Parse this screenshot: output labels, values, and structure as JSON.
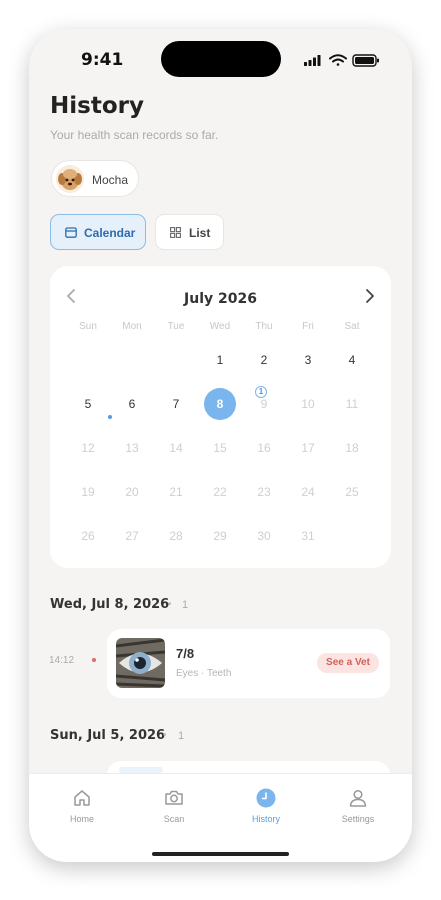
{
  "status": {
    "time": "9:41"
  },
  "header": {
    "title": "History",
    "subtitle": "Your health scan records so far."
  },
  "pet": {
    "name": "Mocha"
  },
  "view_toggle": {
    "calendar_label": "Calendar",
    "list_label": "List",
    "selected": "Calendar"
  },
  "calendar": {
    "month_label": "July 2026",
    "weekdays": [
      "Sun",
      "Mon",
      "Tue",
      "Wed",
      "Thu",
      "Fri",
      "Sat"
    ],
    "selected_day": "8",
    "selected_badge": "1",
    "days": [
      {
        "num": "1",
        "state": "normal"
      },
      {
        "num": "2",
        "state": "normal"
      },
      {
        "num": "3",
        "state": "normal"
      },
      {
        "num": "4",
        "state": "normal"
      },
      {
        "num": "5",
        "state": "normal"
      },
      {
        "num": "6",
        "state": "normal"
      },
      {
        "num": "7",
        "state": "normal"
      },
      {
        "num": "8",
        "state": "selected"
      },
      {
        "num": "9",
        "state": "muted"
      },
      {
        "num": "10",
        "state": "muted"
      },
      {
        "num": "11",
        "state": "muted"
      },
      {
        "num": "12",
        "state": "muted"
      },
      {
        "num": "13",
        "state": "muted"
      },
      {
        "num": "14",
        "state": "muted"
      },
      {
        "num": "15",
        "state": "muted"
      },
      {
        "num": "16",
        "state": "muted"
      },
      {
        "num": "17",
        "state": "muted"
      },
      {
        "num": "18",
        "state": "muted"
      },
      {
        "num": "19",
        "state": "muted"
      },
      {
        "num": "20",
        "state": "muted"
      },
      {
        "num": "21",
        "state": "muted"
      },
      {
        "num": "22",
        "state": "muted"
      },
      {
        "num": "23",
        "state": "muted"
      },
      {
        "num": "24",
        "state": "muted"
      },
      {
        "num": "25",
        "state": "muted"
      },
      {
        "num": "26",
        "state": "muted"
      },
      {
        "num": "27",
        "state": "muted"
      },
      {
        "num": "28",
        "state": "muted"
      },
      {
        "num": "29",
        "state": "muted"
      },
      {
        "num": "30",
        "state": "muted"
      },
      {
        "num": "31",
        "state": "muted"
      }
    ]
  },
  "groups": [
    {
      "date": "Wed, Jul 8, 2026",
      "count": "1",
      "records": [
        {
          "time": "14:12",
          "score": "7/8",
          "tags": "Eyes · Teeth",
          "badge": "See a Vet"
        }
      ]
    },
    {
      "date": "Sun, Jul 5, 2026",
      "count": "1"
    }
  ],
  "separator": "•",
  "tabs": [
    {
      "label": "Home",
      "icon": "home-icon"
    },
    {
      "label": "Scan",
      "icon": "camera-icon"
    },
    {
      "label": "History",
      "icon": "clock-icon",
      "active": true
    },
    {
      "label": "Settings",
      "icon": "person-icon"
    }
  ],
  "colors": {
    "accent": "#7bb5ee",
    "vet_badge_bg": "#fbe4e2",
    "vet_badge_text": "#d0625c",
    "record_dot": "#e06b6b"
  }
}
